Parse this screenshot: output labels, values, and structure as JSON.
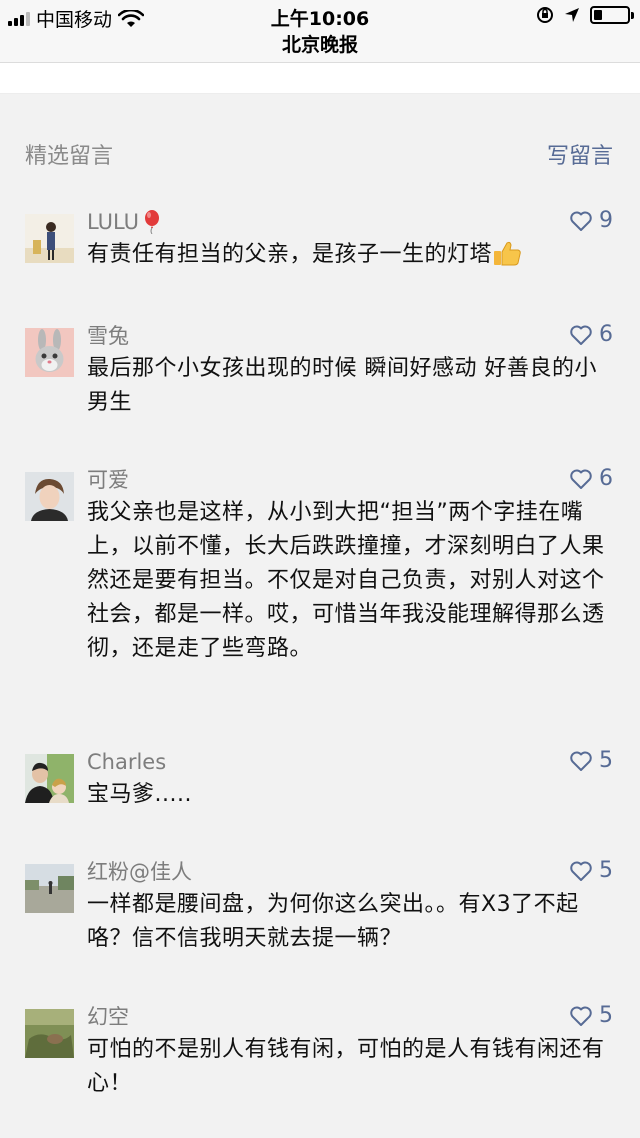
{
  "status_bar": {
    "carrier": "中国移动",
    "time": "上午10:06",
    "battery_fraction": 0.25
  },
  "nav": {
    "title": "北京晚报"
  },
  "section": {
    "title": "精选留言",
    "write_label": "写留言"
  },
  "comments": [
    {
      "name": "LULU",
      "name_emoji": "balloon-icon",
      "likes": "9",
      "text": "有责任有担当的父亲，是孩子一生的灯塔",
      "text_emoji": "thumbs-up-icon"
    },
    {
      "name": "雪兔",
      "likes": "6",
      "text": "最后那个小女孩出现的时候 瞬间好感动 好善良的小男生"
    },
    {
      "name": "可爱",
      "likes": "6",
      "text": "我父亲也是这样，从小到大把“担当”两个字挂在嘴上，以前不懂，长大后跌跌撞撞，才深刻明白了人果然还是要有担当。不仅是对自己负责，对别人对这个社会，都是一样。哎，可惜当年我没能理解得那么透彻，还是走了些弯路。"
    },
    {
      "name": "Charles",
      "likes": "5",
      "text": "宝马爹....."
    },
    {
      "name": "红粉@佳人",
      "likes": "5",
      "text": "一样都是腰间盘，为何你这么突出。。有X3了不起咯？信不信我明天就去提一辆？"
    },
    {
      "name": "幻空",
      "likes": "5",
      "text": "可怕的不是别人有钱有闲，可怕的是人有钱有闲还有心！"
    }
  ],
  "colors": {
    "link": "#576b95",
    "muted": "#8a8a8a",
    "background": "#f2f2f2"
  }
}
